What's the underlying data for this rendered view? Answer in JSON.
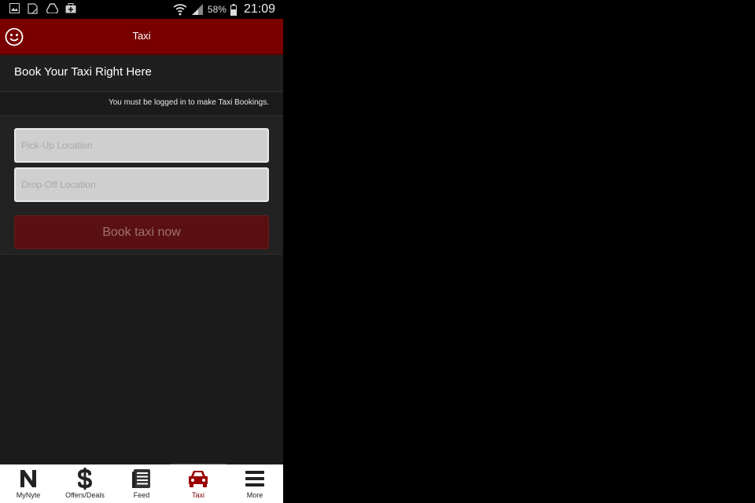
{
  "status_bar": {
    "battery_percent": "58%",
    "time": "21:09",
    "icons": [
      "image-icon",
      "sd-card-icon",
      "drive-icon",
      "bag-icon",
      "wifi-icon",
      "signal-icon",
      "battery-icon"
    ]
  },
  "app_bar": {
    "title": "Taxi",
    "left_icon": "smiley-icon"
  },
  "heading": "Book Your Taxi Right Here",
  "notice": "You must be logged in to make Taxi Bookings.",
  "form": {
    "pickup_placeholder": "Pick-Up Location",
    "dropoff_placeholder": "Drop-Off Location",
    "pickup_value": "",
    "dropoff_value": "",
    "book_label": "Book taxi now"
  },
  "bottom_nav": {
    "items": [
      {
        "label": "MyNyte",
        "icon": "n-logo-icon"
      },
      {
        "label": "Offers/Deals",
        "icon": "dollar-icon"
      },
      {
        "label": "Feed",
        "icon": "feed-icon"
      },
      {
        "label": "Taxi",
        "icon": "car-icon",
        "active": true
      },
      {
        "label": "More",
        "icon": "menu-icon"
      }
    ]
  },
  "colors": {
    "brand": "#7a0000",
    "button": "#5a1010",
    "background": "#1b1b1b"
  }
}
